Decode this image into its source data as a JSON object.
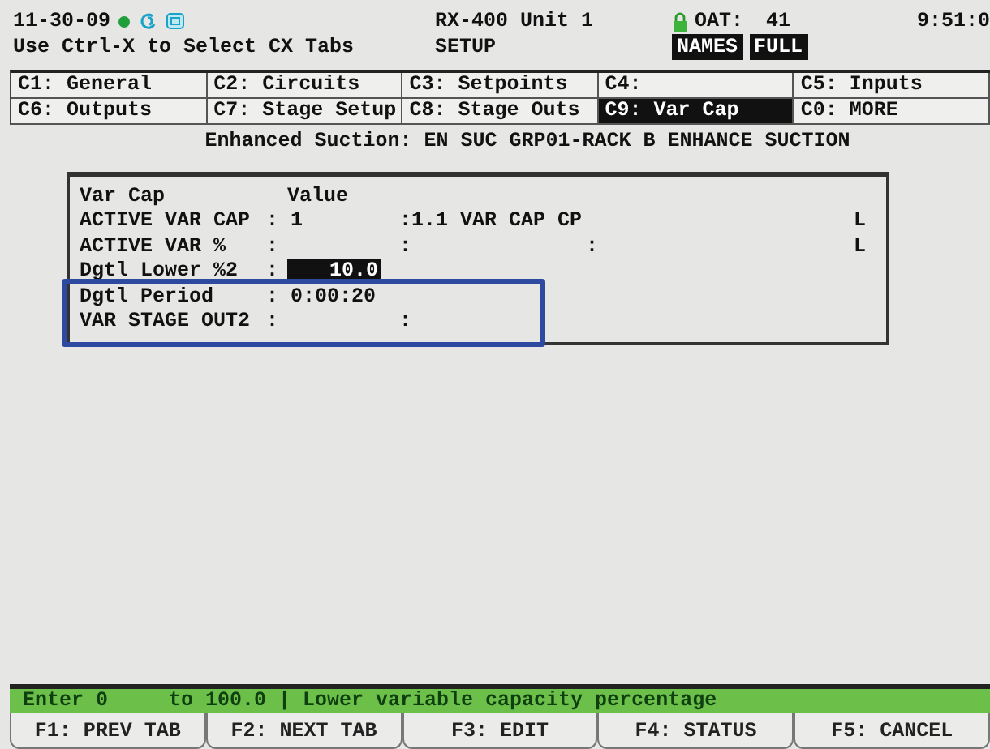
{
  "header": {
    "date": "11-30-09",
    "title": "RX-400 Unit 1",
    "oat_label": "OAT:",
    "oat_value": "41",
    "time": "9:51:0",
    "hint": "Use Ctrl-X to Select CX Tabs",
    "mode": "SETUP",
    "badges": [
      "NAMES",
      "FULL"
    ]
  },
  "tabs": [
    {
      "label": "C1: General",
      "selected": false
    },
    {
      "label": "C2: Circuits",
      "selected": false
    },
    {
      "label": "C3: Setpoints",
      "selected": false
    },
    {
      "label": "C4:",
      "selected": false
    },
    {
      "label": "C5: Inputs",
      "selected": false
    },
    {
      "label": "C6: Outputs",
      "selected": false
    },
    {
      "label": "C7: Stage Setup",
      "selected": false
    },
    {
      "label": "C8: Stage Outs",
      "selected": false
    },
    {
      "label": "C9: Var Cap",
      "selected": true
    },
    {
      "label": "C0: MORE",
      "selected": false
    }
  ],
  "subtitle": "Enhanced Suction: EN SUC GRP01-RACK B ENHANCE SUCTION",
  "table": {
    "columns": [
      "Var Cap",
      "Value"
    ],
    "rows": [
      {
        "label": "ACTIVE VAR CAP",
        "colon": ":",
        "value": "1",
        "ref": ":1.1 VAR CAP CP",
        "flag": "L",
        "selected": false
      },
      {
        "label": "ACTIVE VAR %",
        "colon": ":",
        "ref": ":",
        "ref2": ":",
        "flag": "L",
        "selected": false
      },
      {
        "label": "Dgtl Lower %2",
        "colon": ":",
        "value": "10.0",
        "selected": true
      },
      {
        "label": "Dgtl Period",
        "colon": ":",
        "value": "0:00:20",
        "selected": false
      },
      {
        "label": "VAR STAGE OUT2",
        "colon": ":",
        "ref": ":",
        "selected": false
      }
    ]
  },
  "status_bar": "Enter 0     to 100.0 | Lower variable capacity percentage",
  "function_keys": [
    "F1: PREV TAB",
    "F2: NEXT TAB",
    "F3: EDIT",
    "F4: STATUS",
    "F5: CANCEL"
  ]
}
